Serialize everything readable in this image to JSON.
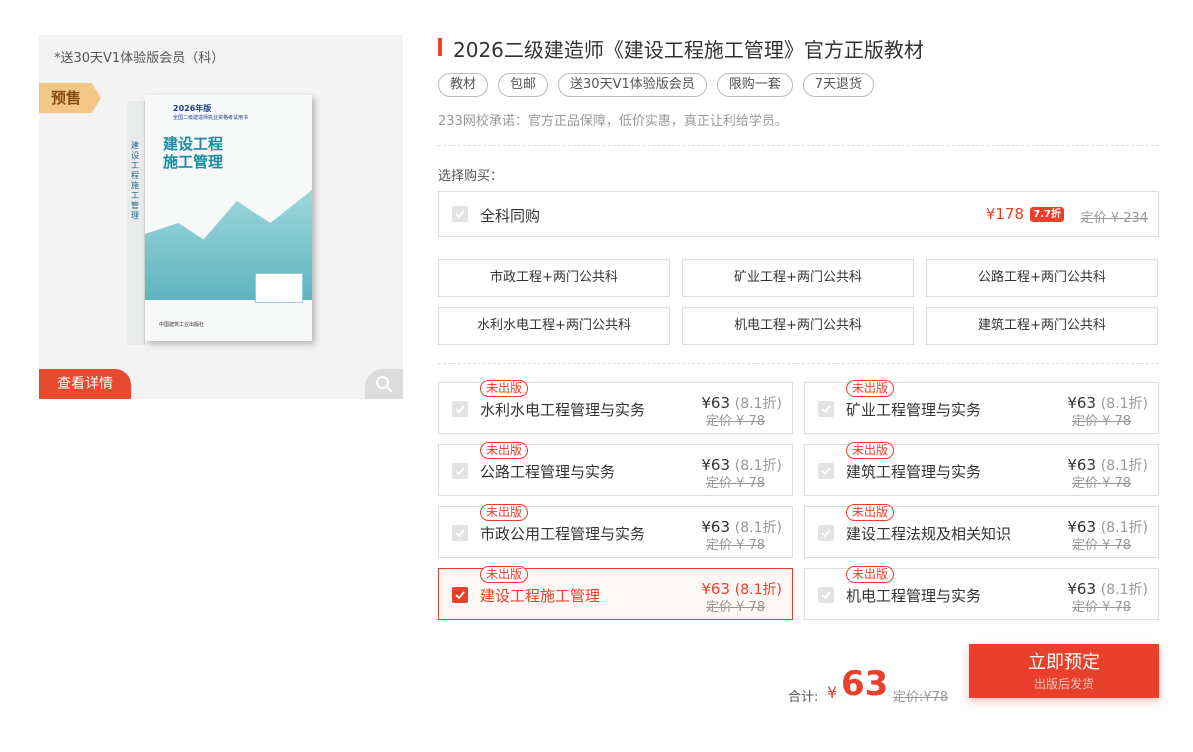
{
  "product_image": {
    "promo_note": "*送30天V1体验版会员（科）",
    "presale_tag": "预售",
    "book": {
      "year": "2026年版",
      "series": "全国二级建造师执业资格考试用书",
      "title_line1": "建设工程",
      "title_line2": "施工管理",
      "spine": "建设工程施工管理",
      "publisher": "中国建筑工业出版社"
    },
    "details_button": "查看详情",
    "zoom_icon": "search-icon"
  },
  "title": "2026二级建造师《建设工程施工管理》官方正版教材",
  "tags": [
    "教材",
    "包邮",
    "送30天V1体验版会员",
    "限购一套",
    "7天退货"
  ],
  "promise": "233网校承诺：官方正品保障，低价实惠，真正让利给学员。",
  "choose_label": "选择购买：",
  "full_set": {
    "label": "全科同购",
    "price": "¥178",
    "discount": "7.7折",
    "original": "定价 ¥ 234",
    "checked": false
  },
  "combos": [
    "市政工程+两门公共科",
    "矿业工程+两门公共科",
    "公路工程+两门公共科",
    "水利水电工程+两门公共科",
    "机电工程+两门公共科",
    "建筑工程+两门公共科"
  ],
  "subjects": [
    {
      "badge": "未出版",
      "name": "水利水电工程管理与实务",
      "price": "¥63",
      "discount": "(8.1折)",
      "original": "定价 ¥ 78",
      "selected": false
    },
    {
      "badge": "未出版",
      "name": "矿业工程管理与实务",
      "price": "¥63",
      "discount": "(8.1折)",
      "original": "定价 ¥ 78",
      "selected": false
    },
    {
      "badge": "未出版",
      "name": "公路工程管理与实务",
      "price": "¥63",
      "discount": "(8.1折)",
      "original": "定价 ¥ 78",
      "selected": false
    },
    {
      "badge": "未出版",
      "name": "建筑工程管理与实务",
      "price": "¥63",
      "discount": "(8.1折)",
      "original": "定价 ¥ 78",
      "selected": false
    },
    {
      "badge": "未出版",
      "name": "市政公用工程管理与实务",
      "price": "¥63",
      "discount": "(8.1折)",
      "original": "定价 ¥ 78",
      "selected": false
    },
    {
      "badge": "未出版",
      "name": "建设工程法规及相关知识",
      "price": "¥63",
      "discount": "(8.1折)",
      "original": "定价 ¥ 78",
      "selected": false
    },
    {
      "badge": "未出版",
      "name": "建设工程施工管理",
      "price": "¥63",
      "discount": "(8.1折)",
      "original": "定价 ¥ 78",
      "selected": true
    },
    {
      "badge": "未出版",
      "name": "机电工程管理与实务",
      "price": "¥63",
      "discount": "(8.1折)",
      "original": "定价 ¥ 78",
      "selected": false
    }
  ],
  "total": {
    "label": "合计:",
    "currency": "¥",
    "value": "63",
    "original": "定价:¥78"
  },
  "order_button": {
    "main": "立即预定",
    "sub": "出版后发货"
  },
  "colors": {
    "accent": "#e8402a",
    "presale": "#f2c785"
  }
}
